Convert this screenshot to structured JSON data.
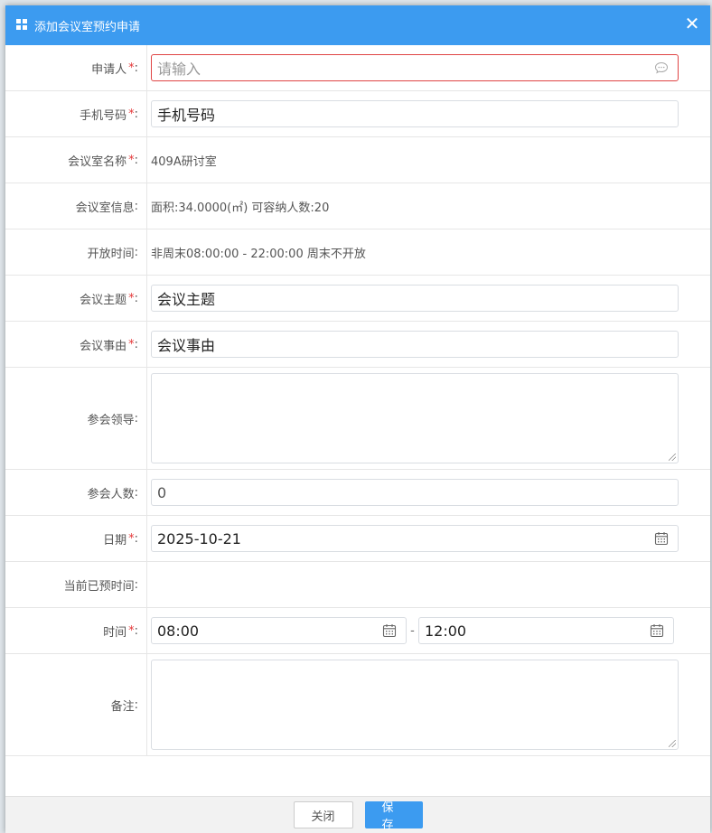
{
  "dialog": {
    "title": "添加会议室预约申请",
    "close_symbol": "✕"
  },
  "form": {
    "applicant": {
      "label": "申请人",
      "required": "*",
      "colon": ":",
      "placeholder": "请输入"
    },
    "phone": {
      "label": "手机号码",
      "required": "*",
      "colon": ":",
      "placeholder": "手机号码"
    },
    "room_name": {
      "label": "会议室名称",
      "required": "*",
      "colon": ":",
      "value": "409A研讨室"
    },
    "room_info": {
      "label": "会议室信息",
      "colon": ":",
      "value": "面积:34.0000(㎡) 可容纳人数:20"
    },
    "open_time": {
      "label": "开放时间",
      "colon": ":",
      "value": "非周末08:00:00 - 22:00:00 周末不开放"
    },
    "topic": {
      "label": "会议主题",
      "required": "*",
      "colon": ":",
      "placeholder": "会议主题"
    },
    "reason": {
      "label": "会议事由",
      "required": "*",
      "colon": ":",
      "placeholder": "会议事由"
    },
    "leaders": {
      "label": "参会领导",
      "colon": ":"
    },
    "attendees": {
      "label": "参会人数",
      "colon": ":",
      "value": "0"
    },
    "date": {
      "label": "日期",
      "required": "*",
      "colon": ":",
      "value": "2025-10-21"
    },
    "booked": {
      "label": "当前已预时间",
      "colon": ":"
    },
    "time": {
      "label": "时间",
      "required": "*",
      "colon": ":",
      "start": "08:00",
      "separator": "-",
      "end": "12:00"
    },
    "remark": {
      "label": "备注",
      "colon": ":"
    }
  },
  "footer": {
    "close_label": "关闭",
    "save_label": "保存"
  },
  "colors": {
    "accent": "#3c9bf0",
    "required": "#e5393a",
    "error_border": "#e04444"
  }
}
